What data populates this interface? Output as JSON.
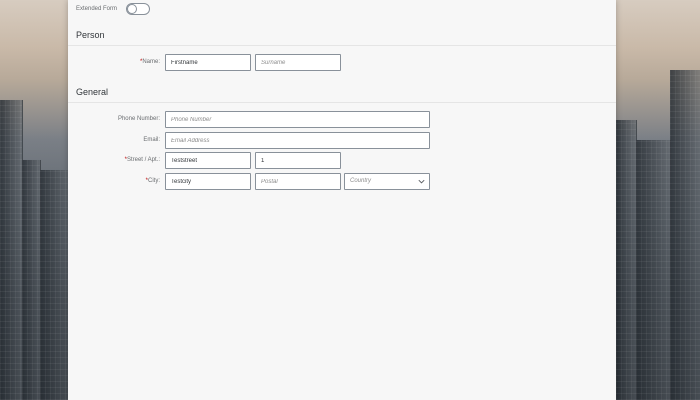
{
  "toolbar": {
    "extended_form_label": "Extended Form",
    "extended_form_on": false
  },
  "sections": {
    "person": {
      "title": "Person"
    },
    "general": {
      "title": "General"
    }
  },
  "person": {
    "name_label": "Name:",
    "name_required": "*",
    "firstname_value": "Firstname",
    "surname_placeholder": "Surname"
  },
  "general": {
    "phone_label": "Phone Number:",
    "phone_placeholder": "Phone Number",
    "email_label": "Email:",
    "email_placeholder": "Email Address",
    "street_label": "Street / Apt.:",
    "street_required": "*",
    "street_value": "Teststreet",
    "apt_value": "1",
    "city_label": "City:",
    "city_required": "*",
    "city_value": "Testcity",
    "postal_placeholder": "Postal",
    "country_placeholder": "Country"
  },
  "colors": {
    "required": "#bb0000",
    "sheet_bg": "#f7f7f7",
    "field_border": "#89919a"
  },
  "icons": {
    "country_dropdown": "chevron-down-icon"
  }
}
